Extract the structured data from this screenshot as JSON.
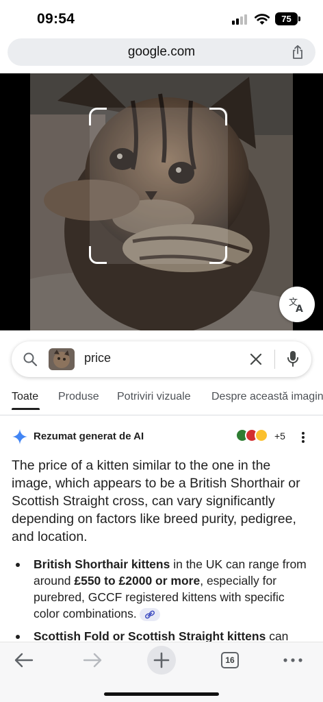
{
  "status_bar": {
    "time": "09:54",
    "battery": "75"
  },
  "browser": {
    "url": "google.com"
  },
  "search": {
    "query": "price",
    "thumbnail": "kitten-thumbnail"
  },
  "tabs": [
    {
      "label": "Toate",
      "active": true
    },
    {
      "label": "Produse",
      "active": false
    },
    {
      "label": "Potriviri vizuale",
      "active": false
    },
    {
      "label": "Despre această imagine",
      "active": false
    }
  ],
  "ai_overview": {
    "title": "Rezumat generat de AI",
    "sources_more": "+5",
    "paragraph": "The price of a kitten similar to the one in the image, which appears to be a British Shorthair or Scottish Straight cross, can vary significantly depending on factors like breed purity, pedigree, and location.",
    "bullets": [
      {
        "bold1": "British Shorthair kittens",
        "text1": " in the UK can range from around ",
        "bold2": "£550 to £2000 or more",
        "text2": ", especially for purebred, GCCF registered kittens with specific color combinations."
      },
      {
        "bold1": "Scottish Fold or Scottish Straight kittens",
        "text1": " can",
        "bold2": "",
        "text2": ""
      }
    ]
  },
  "bottom_bar": {
    "tab_count": "16"
  },
  "colors": {
    "accent_blue": "#4285f4",
    "chrome_bar": "#ebedf0",
    "text": "#1f1f1f"
  }
}
